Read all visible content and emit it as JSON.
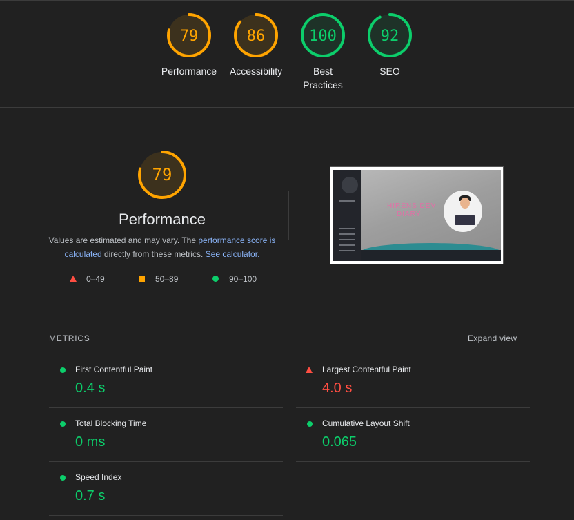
{
  "categories": [
    {
      "label": "Performance",
      "score": "79",
      "value": 0.79,
      "color": "#ffa400"
    },
    {
      "label": "Accessibility",
      "score": "86",
      "value": 0.86,
      "color": "#ffa400"
    },
    {
      "label": "Best\nPractices",
      "score": "100",
      "value": 1.0,
      "color": "#0cce6b"
    },
    {
      "label": "SEO",
      "score": "92",
      "value": 0.92,
      "color": "#0cce6b"
    }
  ],
  "performance": {
    "score": "79",
    "value": 0.79,
    "title": "Performance",
    "desc_prefix": "Values are estimated and may vary. The ",
    "score_link": "performance score is calculated",
    "desc_middle": " directly from these metrics. ",
    "calc_link": "See calculator.",
    "legend": {
      "fail": "0–49",
      "average": "50–89",
      "pass": "90–100"
    }
  },
  "screenshot": {
    "text_line1": "HIRENS DEV",
    "text_line2": "DIARY"
  },
  "metrics": {
    "title": "METRICS",
    "expand_label": "Expand view",
    "items": [
      {
        "label": "First Contentful Paint",
        "value": "0.4 s",
        "status": "pass"
      },
      {
        "label": "Largest Contentful Paint",
        "value": "4.0 s",
        "status": "fail"
      },
      {
        "label": "Total Blocking Time",
        "value": "0 ms",
        "status": "pass"
      },
      {
        "label": "Cumulative Layout Shift",
        "value": "0.065",
        "status": "pass"
      },
      {
        "label": "Speed Index",
        "value": "0.7 s",
        "status": "pass"
      }
    ]
  },
  "colors": {
    "pass": "#0cce6b",
    "average": "#ffa400",
    "fail": "#ff4e42",
    "link": "#8ab4f8"
  }
}
